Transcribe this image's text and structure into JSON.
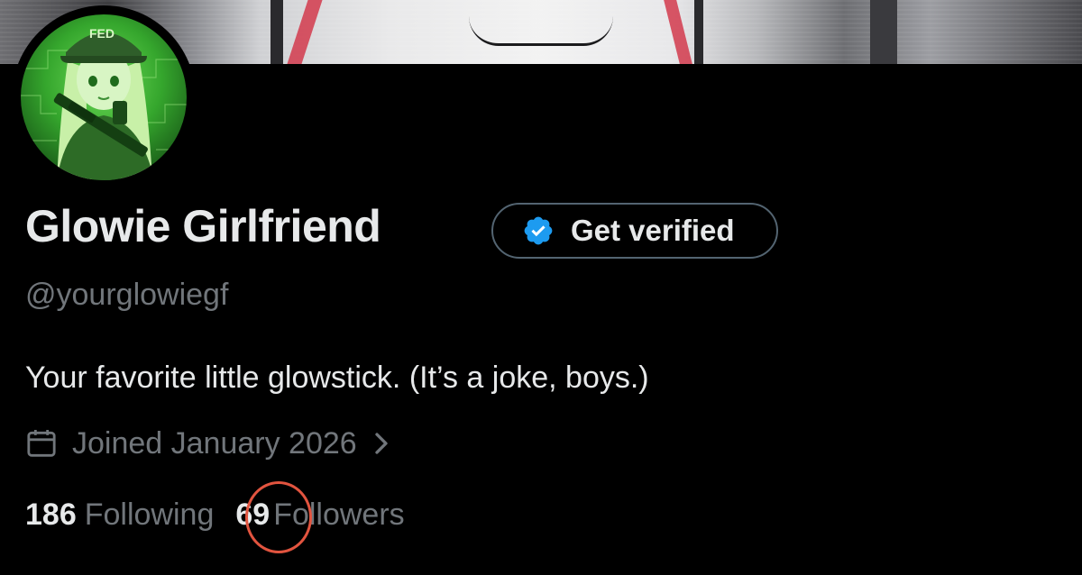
{
  "banner": {
    "icon": "header-banner-image"
  },
  "avatar": {
    "icon": "profile-avatar",
    "cap_text": "FED",
    "tint": "#4cc03a"
  },
  "profile": {
    "display_name": "Glowie Girlfriend",
    "handle": "@yourglowiegf",
    "bio": "Your favorite little glowstick. (It’s a joke, boys.)",
    "joined": "Joined January 2026"
  },
  "verify_button": {
    "label": "Get verified",
    "icon": "verified-badge-icon",
    "badge_color": "#1d9bf0"
  },
  "stats": {
    "following_count": "186",
    "following_label": "Following",
    "followers_count": "69",
    "followers_label": "Followers"
  },
  "annotation": {
    "circle_color": "#e2543f",
    "circled_item": "followers_count"
  },
  "colors": {
    "background": "#000000",
    "text_primary": "#e7e9ea",
    "text_secondary": "#71767b",
    "border": "#536471"
  }
}
